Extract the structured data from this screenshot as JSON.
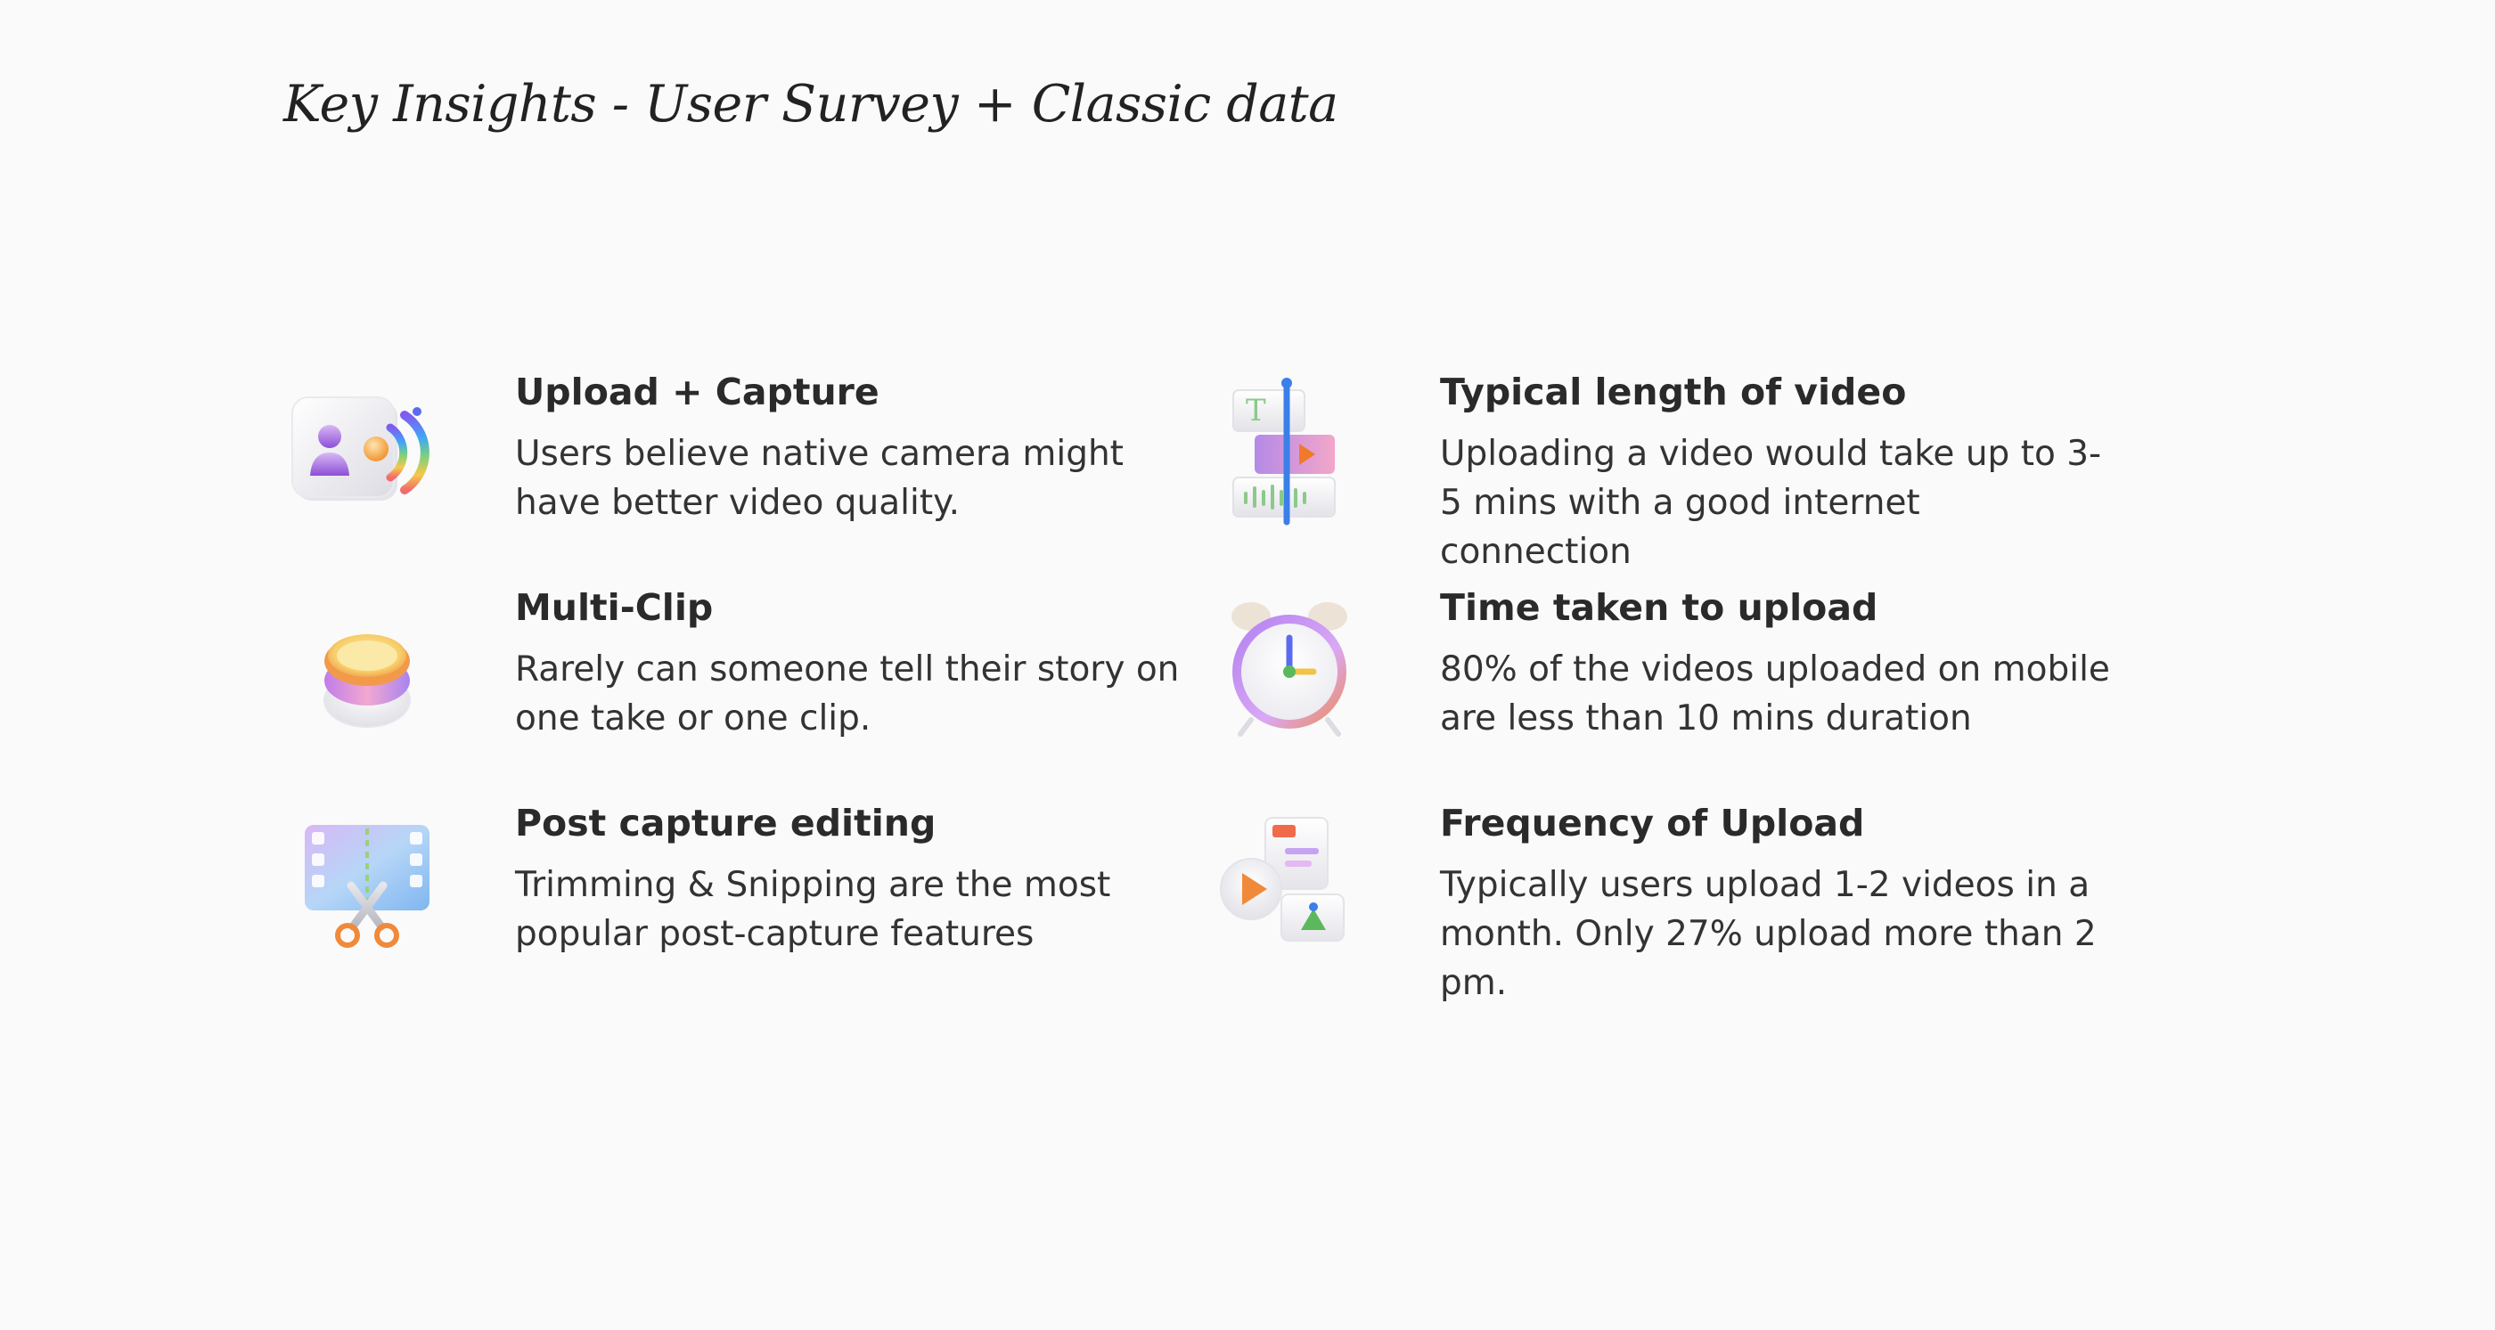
{
  "page": {
    "title": "Key Insights - User Survey + Classic data"
  },
  "insights": [
    {
      "icon": "camera-upload-icon",
      "title": "Upload + Capture",
      "body": "Users believe native camera might have better video quality."
    },
    {
      "icon": "video-timeline-icon",
      "title": "Typical length of video",
      "body": "Uploading a video would take up to 3-5 mins with a good internet connection"
    },
    {
      "icon": "stacked-clips-icon",
      "title": "Multi-Clip",
      "body": "Rarely can someone tell their story on one take or one clip."
    },
    {
      "icon": "alarm-clock-icon",
      "title": "Time taken to upload",
      "body": "80% of the videos uploaded on mobile are less than 10 mins duration"
    },
    {
      "icon": "film-scissors-icon",
      "title": "Post capture editing",
      "body": "Trimming & Snipping are the most popular post-capture features"
    },
    {
      "icon": "media-files-icon",
      "title": "Frequency of Upload",
      "body": "Typically users upload 1-2 videos in a month. Only 27% upload more than 2 pm."
    }
  ]
}
